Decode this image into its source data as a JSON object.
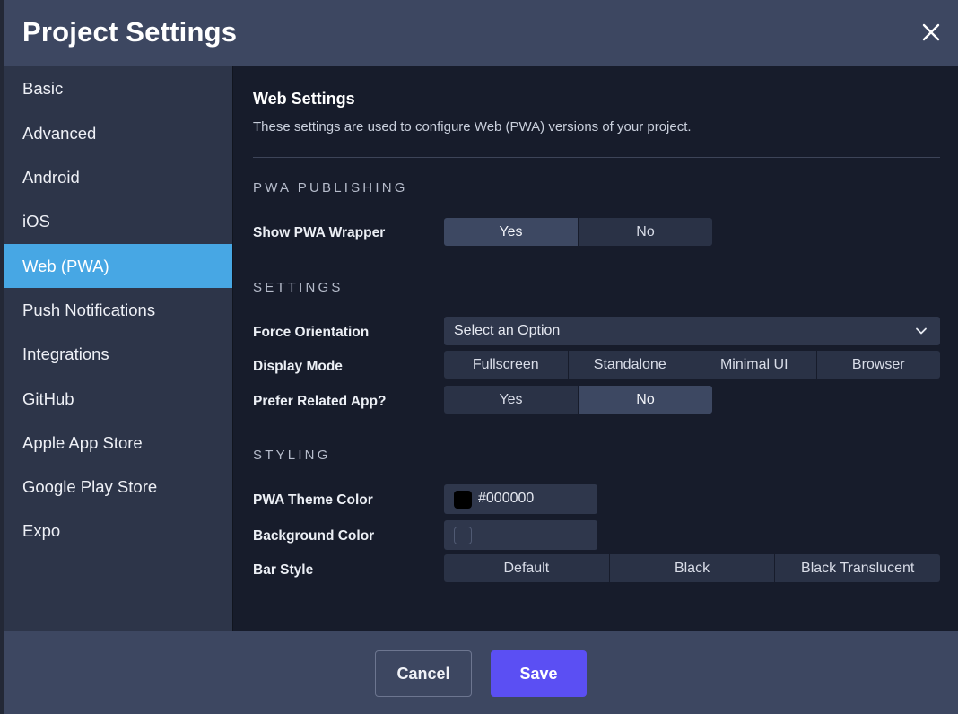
{
  "dialog": {
    "title": "Project Settings"
  },
  "sidebar": {
    "items": [
      {
        "label": "Basic"
      },
      {
        "label": "Advanced"
      },
      {
        "label": "Android"
      },
      {
        "label": "iOS"
      },
      {
        "label": "Web (PWA)",
        "active": true
      },
      {
        "label": "Push Notifications"
      },
      {
        "label": "Integrations"
      },
      {
        "label": "GitHub"
      },
      {
        "label": "Apple App Store"
      },
      {
        "label": "Google Play Store"
      },
      {
        "label": "Expo"
      }
    ]
  },
  "main": {
    "title": "Web Settings",
    "description": "These settings are used to configure Web (PWA) versions of your project.",
    "pwa_publishing": {
      "heading": "PWA PUBLISHING",
      "show_wrapper": {
        "label": "Show PWA Wrapper",
        "options": [
          "Yes",
          "No"
        ],
        "selected": "Yes"
      }
    },
    "settings": {
      "heading": "SETTINGS",
      "force_orientation": {
        "label": "Force Orientation",
        "value": "Select an Option"
      },
      "display_mode": {
        "label": "Display Mode",
        "options": [
          "Fullscreen",
          "Standalone",
          "Minimal UI",
          "Browser"
        ],
        "selected": null
      },
      "prefer_related_app": {
        "label": "Prefer Related App?",
        "options": [
          "Yes",
          "No"
        ],
        "selected": "No"
      }
    },
    "styling": {
      "heading": "STYLING",
      "theme_color": {
        "label": "PWA Theme Color",
        "value": "#000000",
        "swatch": "#000000"
      },
      "background_color": {
        "label": "Background Color",
        "value": "",
        "swatch": "#2f374c"
      },
      "bar_style": {
        "label": "Bar Style",
        "options": [
          "Default",
          "Black",
          "Black Translucent"
        ],
        "selected": null
      }
    }
  },
  "footer": {
    "cancel_label": "Cancel",
    "save_label": "Save"
  },
  "colors": {
    "accent": "#5b4ff3",
    "active_nav": "#47a7e4"
  },
  "icons": {
    "close": "close-icon",
    "chevron": "chevron-down-icon"
  }
}
